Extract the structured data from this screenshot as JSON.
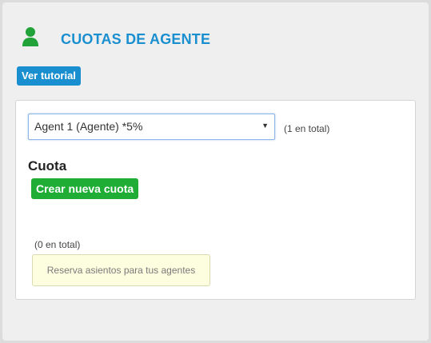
{
  "header": {
    "title": "CUOTAS DE AGENTE",
    "icon": "user-icon",
    "icon_color": "#21a33a",
    "title_color": "#1a8fd0"
  },
  "toolbar": {
    "tutorial_label": "Ver tutorial"
  },
  "agent_select": {
    "selected": "Agent 1 (Agente) *5%",
    "arrow": "▼",
    "total_text": "(1 en total)"
  },
  "quota": {
    "section_title": "Cuota",
    "create_label": "Crear nueva cuota",
    "total_text": "(0 en total)",
    "notice_text": "Reserva asientos para tus agentes",
    "create_color": "#1fad36"
  }
}
